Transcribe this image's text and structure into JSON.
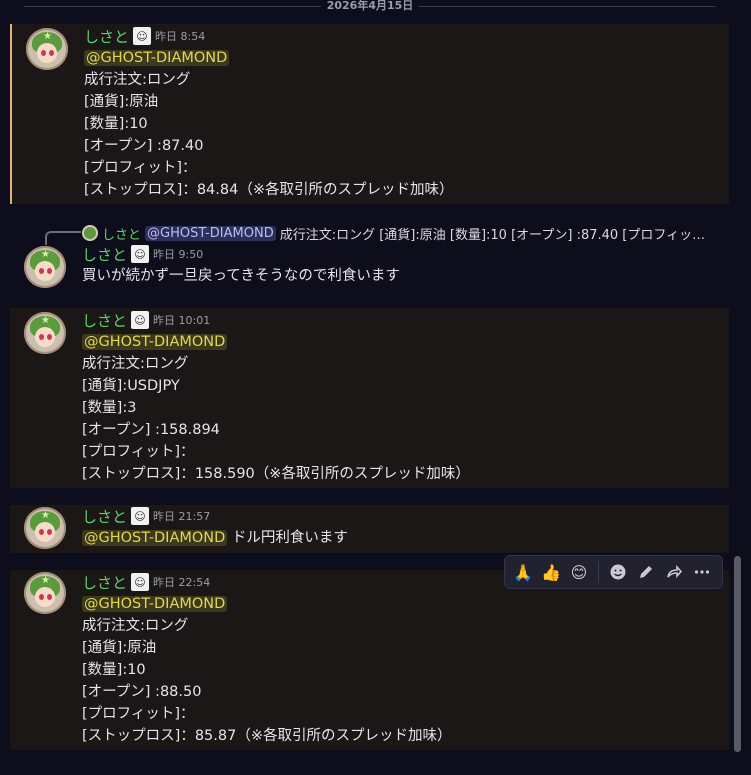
{
  "date_divider": "2026年4月15日",
  "messages": [
    {
      "author": "しさと",
      "time": "昨日 8:54",
      "mention": "@GHOST-DIAMOND",
      "lines": [
        "成行注文:ロング",
        "[通貨]:原油",
        "[数量]:10",
        "[オープン] :87.40",
        "[プロフィット]：",
        "[ストップロス]：84.84（※各取引所のスプレッド加味）"
      ]
    },
    {
      "reply": {
        "author": "しさと",
        "mention": "@GHOST-DIAMOND",
        "text": "成行注文:ロング [通貨]:原油 [数量]:10 [オープン] :87.40 [プロフィッ…"
      },
      "author": "しさと",
      "time": "昨日 9:50",
      "text": "買いが続かず一旦戻ってきそうなので利食います"
    },
    {
      "author": "しさと",
      "time": "昨日 10:01",
      "mention": "@GHOST-DIAMOND",
      "lines": [
        "成行注文:ロング",
        "[通貨]:USDJPY",
        "[数量]:3",
        "[オープン] :158.894",
        "[プロフィット]：",
        "[ストップロス]：158.590（※各取引所のスプレッド加味）"
      ]
    },
    {
      "author": "しさと",
      "time": "昨日 21:57",
      "mention": "@GHOST-DIAMOND",
      "text": "ドル円利食います"
    },
    {
      "author": "しさと",
      "time": "昨日 22:54",
      "mention": "@GHOST-DIAMOND",
      "lines": [
        "成行注文:ロング",
        "[通貨]:原油",
        "[数量]:10",
        "[オープン] :88.50",
        "[プロフィット]：",
        "[ストップロス]：85.87（※各取引所のスプレッド加味）"
      ]
    }
  ],
  "toolbar": {
    "items": [
      "🙏",
      "👍",
      "😊"
    ],
    "icons": [
      "add-reaction-icon",
      "edit-icon",
      "forward-icon",
      "more-icon"
    ]
  },
  "colors": {
    "author": "#5fd36c",
    "mention_bg": "#3b3a1a",
    "mention_fg": "#e6d45a",
    "highlight_bar": "#e3b072"
  }
}
